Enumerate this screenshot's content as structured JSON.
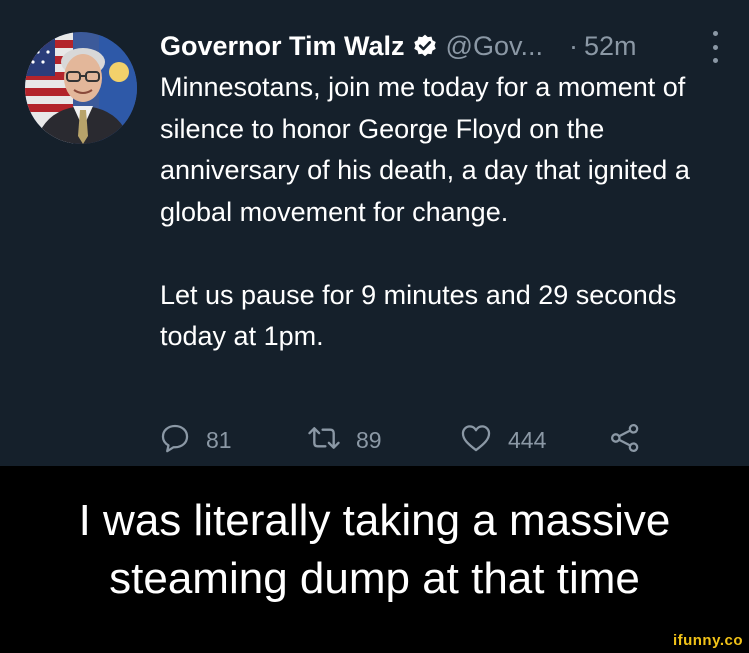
{
  "tweet": {
    "author_name": "Governor Tim Walz",
    "handle": "@Gov...",
    "separator": "·",
    "time": "52m",
    "body_paragraphs": [
      "Minnesotans, join me today for a moment of silence to honor George Floyd on the anniversary of his death, a day that ignited a global movement for change.",
      "Let us pause for 9 minutes and 29 seconds today at 1pm."
    ],
    "actions": {
      "reply_count": "81",
      "retweet_count": "89",
      "like_count": "444"
    },
    "icons": [
      "verified-badge-icon",
      "more-icon",
      "reply-icon",
      "retweet-icon",
      "like-icon",
      "share-icon"
    ]
  },
  "meme": {
    "caption_line_1": "I was literally taking a massive",
    "caption_line_2": "steaming dump at that time",
    "watermark": "ifunny.co"
  },
  "colors": {
    "tweet_background": "#15202b",
    "page_background": "#000000",
    "secondary_text": "#8b98a5",
    "verified_badge": "#ffffff",
    "watermark": "#f2c318"
  }
}
